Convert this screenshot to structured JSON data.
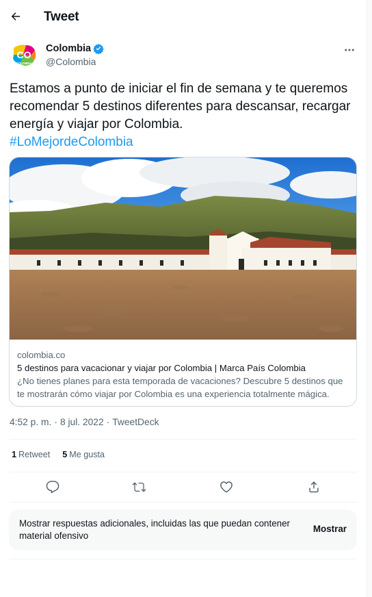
{
  "header": {
    "title": "Tweet"
  },
  "author": {
    "name": "Colombia",
    "handle": "@Colombia",
    "avatar_text": "CO",
    "avatar_subtext": "COLOMBIA"
  },
  "tweet": {
    "text": "Estamos a punto de iniciar el fin de semana y te queremos recomendar 5 destinos diferentes para descansar, recargar energía y viajar por Colombia.",
    "hashtag": "#LoMejordeColombia"
  },
  "card": {
    "domain": "colombia.co",
    "title": "5 destinos para vacacionar y viajar por Colombia | Marca País Colombia",
    "description": "¿No tienes planes para esta temporada de vacaciones? Descubre 5 destinos que te mostrarán cómo viajar por Colombia es una experiencia totalmente mágica."
  },
  "meta": {
    "time": "4:52 p. m.",
    "separator": "·",
    "date": "8 jul. 2022",
    "source": "TweetDeck"
  },
  "stats": {
    "retweets": {
      "count": "1",
      "label": "Retweet"
    },
    "likes": {
      "count": "5",
      "label": "Me gusta"
    }
  },
  "actions": [
    "reply-icon",
    "retweet-icon",
    "like-icon",
    "share-icon"
  ],
  "more_replies": {
    "text": "Mostrar respuestas adicionales, incluidas las que puedan contener material ofensivo",
    "button": "Mostrar"
  },
  "colors": {
    "accent": "#1d9bf0",
    "text": "#0f1419",
    "muted": "#536471",
    "border": "#cfd9de"
  }
}
